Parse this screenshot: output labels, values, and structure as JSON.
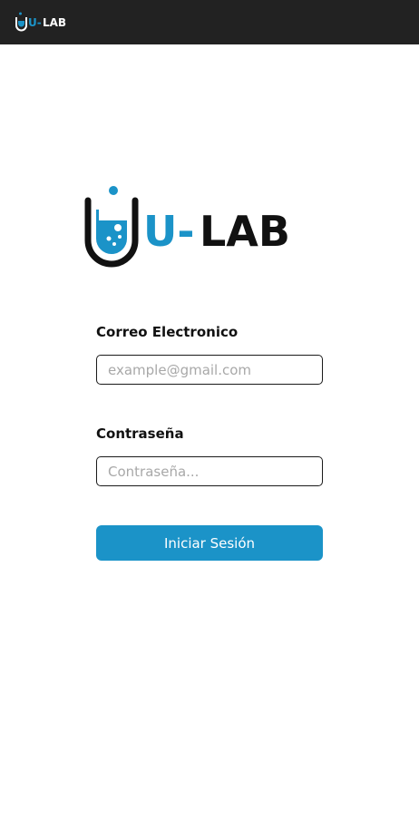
{
  "brand": {
    "logo_text": "U-LAB",
    "logo_prefix": "U-",
    "logo_suffix": "LAB",
    "icon": "test-tube-icon",
    "accent_color": "#1b93c8",
    "dark_color": "#111111"
  },
  "header": {
    "background_color": "#222222"
  },
  "form": {
    "email": {
      "label": "Correo Electronico",
      "placeholder": "example@gmail.com",
      "value": ""
    },
    "password": {
      "label": "Contraseña",
      "placeholder": "Contraseña...",
      "value": ""
    },
    "submit_label": "Iniciar Sesión"
  }
}
